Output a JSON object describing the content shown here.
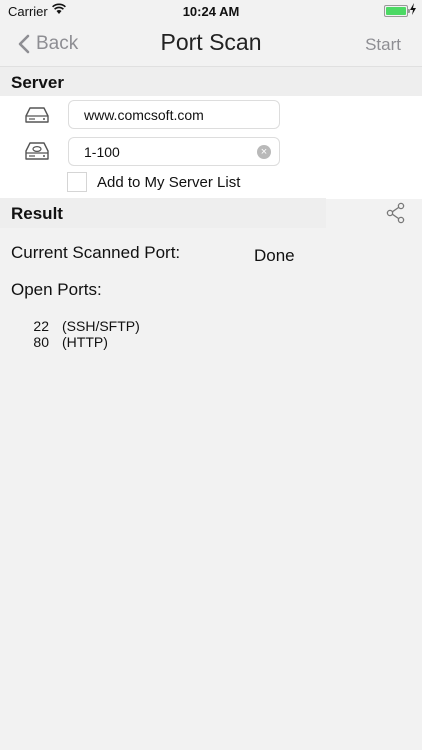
{
  "status_bar": {
    "carrier": "Carrier",
    "time": "10:24 AM",
    "battery_color": "#4cd964"
  },
  "nav": {
    "back_label": "Back",
    "title": "Port Scan",
    "start_label": "Start"
  },
  "server": {
    "header": "Server",
    "host_value": "www.comcsoft.com",
    "host_icon": "server-drive-icon",
    "ports_value": "1-100",
    "ports_icon": "port-range-drive-icon",
    "checkbox_label": "Add to My Server List",
    "checkbox_checked": false
  },
  "result": {
    "header": "Result",
    "share_icon": "share-icon",
    "current_label": "Current Scanned Port:",
    "current_value": "Done",
    "open_label": "Open Ports:",
    "open_ports": [
      {
        "port": "22",
        "service": "(SSH/SFTP)"
      },
      {
        "port": "80",
        "service": "(HTTP)"
      }
    ]
  }
}
